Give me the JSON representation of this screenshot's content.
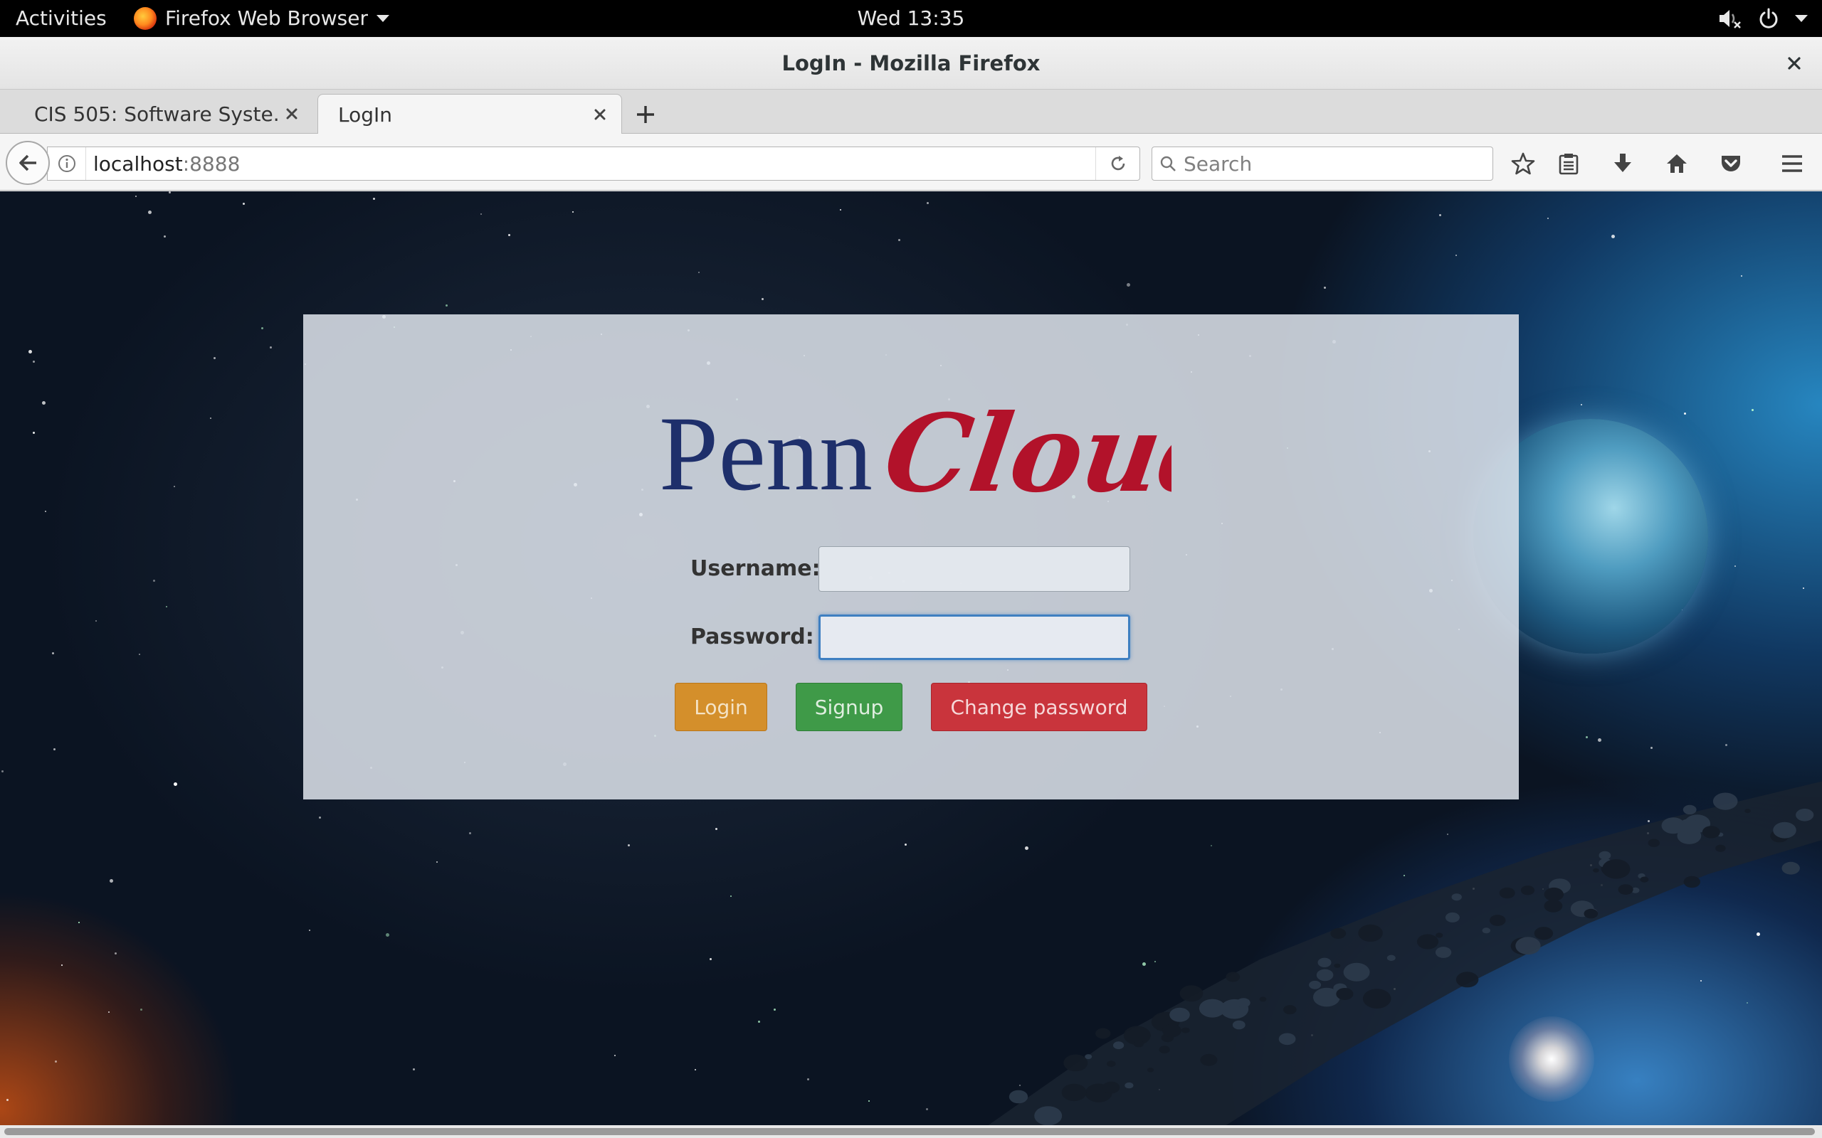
{
  "topbar": {
    "activities": "Activities",
    "app_menu": "Firefox Web Browser",
    "clock": "Wed 13:35"
  },
  "window": {
    "title": "LogIn - Mozilla Firefox"
  },
  "tabs": [
    {
      "label": "CIS 505: Software Syste...",
      "active": false
    },
    {
      "label": "LogIn",
      "active": true
    }
  ],
  "navbar": {
    "url_host": "localhost",
    "url_port": ":8888",
    "search_placeholder": "Search"
  },
  "page": {
    "logo": {
      "penn": "Penn",
      "cloud": "Cloud",
      "penn_color": "#1e2f6b",
      "cloud_color": "#b2122a"
    },
    "form": {
      "username_label": "Username:",
      "password_label": "Password:",
      "username_value": "",
      "password_value": ""
    },
    "buttons": {
      "login": "Login",
      "signup": "Signup",
      "change_password": "Change password"
    }
  },
  "colors": {
    "login_button": "#d48f2b",
    "signup_button": "#3f9a48",
    "change_password_button": "#c9343c",
    "focus_ring": "#3e7fc1"
  }
}
